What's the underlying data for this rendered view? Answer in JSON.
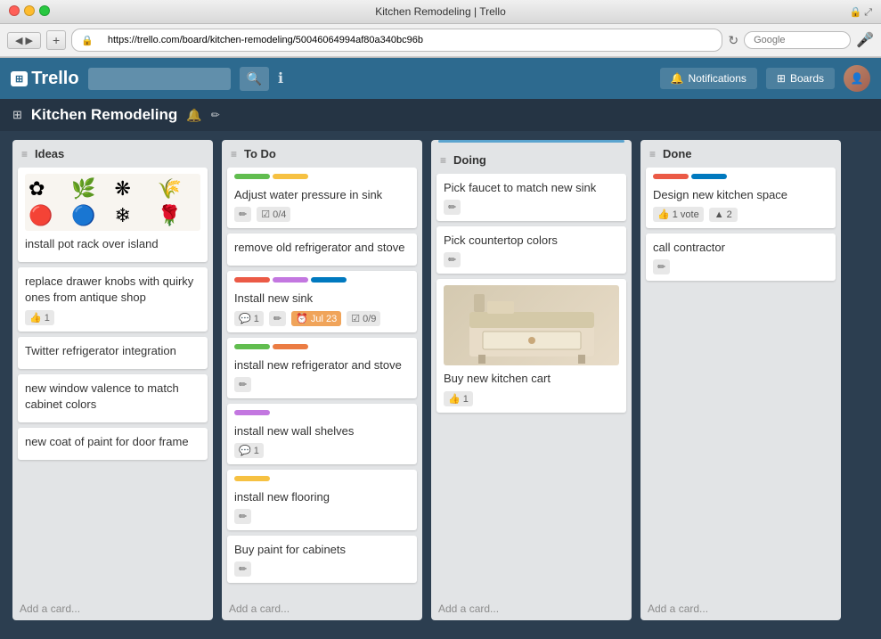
{
  "window": {
    "title": "Kitchen Remodeling | Trello",
    "url": "https://trello.com/board/kitchen-remodeling/50046064994af80a340bc96b"
  },
  "header": {
    "logo": "Trello",
    "logo_icon": "⊞",
    "search_placeholder": "",
    "notifications_label": "Notifications",
    "boards_label": "Boards"
  },
  "board": {
    "title": "Kitchen Remodeling",
    "lists": [
      {
        "id": "ideas",
        "title": "Ideas",
        "cards": [
          {
            "id": "c1",
            "title": "install pot rack over island",
            "has_image": true,
            "labels": [],
            "badges": []
          },
          {
            "id": "c2",
            "title": "replace drawer knobs with quirky ones from antique shop",
            "has_image": false,
            "labels": [],
            "badges": [
              {
                "type": "vote",
                "count": "1"
              }
            ]
          },
          {
            "id": "c3",
            "title": "Twitter refrigerator integration",
            "has_image": false,
            "labels": [],
            "badges": []
          },
          {
            "id": "c4",
            "title": "new window valence to match cabinet colors",
            "has_image": false,
            "labels": [],
            "badges": []
          },
          {
            "id": "c5",
            "title": "new coat of paint for door frame",
            "has_image": false,
            "labels": [],
            "badges": []
          }
        ],
        "add_label": "Add a card..."
      },
      {
        "id": "todo",
        "title": "To Do",
        "cards": [
          {
            "id": "c6",
            "title": "Adjust water pressure in sink",
            "has_image": false,
            "labels": [
              "green",
              "yellow"
            ],
            "badges": [
              {
                "type": "edit"
              },
              {
                "type": "checklist",
                "text": "0/4"
              }
            ]
          },
          {
            "id": "c7",
            "title": "remove old refrigerator and stove",
            "has_image": false,
            "labels": [],
            "badges": []
          },
          {
            "id": "c8",
            "title": "Install new sink",
            "has_image": false,
            "labels": [
              "red",
              "purple",
              "blue"
            ],
            "badges": [
              {
                "type": "comment",
                "count": "1"
              },
              {
                "type": "edit"
              },
              {
                "type": "due",
                "text": "Jul 23"
              },
              {
                "type": "checklist",
                "text": "0/9"
              }
            ]
          },
          {
            "id": "c9",
            "title": "install new refrigerator and stove",
            "has_image": false,
            "labels": [
              "green",
              "orange"
            ],
            "badges": [
              {
                "type": "edit"
              }
            ]
          },
          {
            "id": "c10",
            "title": "install new wall shelves",
            "has_image": false,
            "labels": [
              "purple"
            ],
            "badges": [
              {
                "type": "comment",
                "count": "1"
              }
            ]
          },
          {
            "id": "c11",
            "title": "install new flooring",
            "has_image": false,
            "labels": [
              "yellow"
            ],
            "badges": [
              {
                "type": "edit"
              }
            ]
          },
          {
            "id": "c12",
            "title": "Buy paint for cabinets",
            "has_image": false,
            "labels": [],
            "badges": [
              {
                "type": "edit"
              }
            ]
          }
        ],
        "add_label": "Add a card..."
      },
      {
        "id": "doing",
        "title": "Doing",
        "cards": [
          {
            "id": "c13",
            "title": "Pick faucet to match new sink",
            "has_image": false,
            "labels": [],
            "badges": [
              {
                "type": "edit"
              }
            ]
          },
          {
            "id": "c14",
            "title": "Pick countertop colors",
            "has_image": false,
            "labels": [],
            "badges": [
              {
                "type": "edit"
              }
            ]
          },
          {
            "id": "c15",
            "title": "Buy new kitchen cart",
            "has_image": true,
            "labels": [],
            "badges": [
              {
                "type": "vote",
                "count": "1"
              }
            ]
          }
        ],
        "add_label": "Add a card..."
      },
      {
        "id": "done",
        "title": "Done",
        "cards": [
          {
            "id": "c16",
            "title": "Design new kitchen space",
            "has_image": false,
            "labels": [],
            "badges": [
              {
                "type": "vote",
                "count": "1"
              },
              {
                "type": "voteval",
                "count": "2"
              }
            ]
          },
          {
            "id": "c17",
            "title": "call contractor",
            "has_image": false,
            "labels": [],
            "badges": [
              {
                "type": "edit"
              }
            ]
          }
        ],
        "add_label": "Add a card..."
      }
    ]
  }
}
